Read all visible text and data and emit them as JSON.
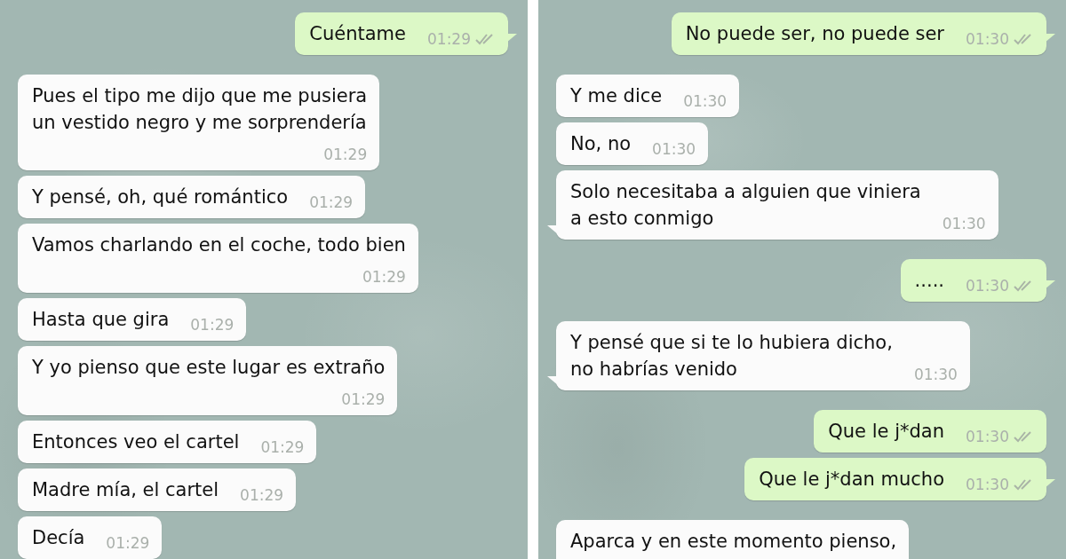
{
  "panels": [
    {
      "messages": [
        {
          "outgoing": true,
          "text": "Cuéntame",
          "time": "01:29",
          "read": false,
          "tail": true,
          "kind": "inline"
        },
        {
          "outgoing": false,
          "text": "Pues el tipo me dijo que me pusiera\nun vestido negro y me sorprendería",
          "time": "01:29",
          "tail": false,
          "kind": "stacked"
        },
        {
          "outgoing": false,
          "text": "Y pensé, oh, qué romántico",
          "time": "01:29",
          "tail": false,
          "kind": "inline"
        },
        {
          "outgoing": false,
          "text": "Vamos charlando en el coche, todo bien",
          "time": "01:29",
          "tail": false,
          "kind": "stacked"
        },
        {
          "outgoing": false,
          "text": "Hasta que gira",
          "time": "01:29",
          "tail": false,
          "kind": "inline"
        },
        {
          "outgoing": false,
          "text": "Y yo pienso que este lugar es extraño",
          "time": "01:29",
          "tail": false,
          "kind": "stacked"
        },
        {
          "outgoing": false,
          "text": "Entonces veo el cartel",
          "time": "01:29",
          "tail": false,
          "kind": "inline"
        },
        {
          "outgoing": false,
          "text": "Madre mía, el cartel",
          "time": "01:29",
          "tail": false,
          "kind": "inline"
        },
        {
          "outgoing": false,
          "text": "Decía",
          "time": "01:29",
          "tail": false,
          "kind": "inline"
        }
      ]
    },
    {
      "messages": [
        {
          "outgoing": true,
          "text": "No puede ser, no puede ser",
          "time": "01:30",
          "read": false,
          "tail": true,
          "kind": "inline"
        },
        {
          "outgoing": false,
          "text": "Y me dice",
          "time": "01:30",
          "tail": false,
          "kind": "inline"
        },
        {
          "outgoing": false,
          "text": "No, no",
          "time": "01:30",
          "tail": false,
          "kind": "inline"
        },
        {
          "outgoing": false,
          "text": "Solo necesitaba a alguien que viniera\na esto conmigo",
          "time": "01:30",
          "tail": true,
          "kind": "inline"
        },
        {
          "outgoing": true,
          "text": ".....",
          "time": "01:30",
          "read": false,
          "tail": true,
          "kind": "inline"
        },
        {
          "outgoing": false,
          "text": "Y pensé que si te lo hubiera dicho,\nno habrías venido",
          "time": "01:30",
          "tail": true,
          "kind": "inline"
        },
        {
          "outgoing": true,
          "text": "Que le j*dan",
          "time": "01:30",
          "read": false,
          "tail": false,
          "kind": "inline"
        },
        {
          "outgoing": true,
          "text": "Que le j*dan mucho",
          "time": "01:30",
          "read": false,
          "tail": true,
          "kind": "inline"
        },
        {
          "outgoing": false,
          "text": "Aparca y en este momento pienso,",
          "kind": "cut"
        }
      ]
    }
  ]
}
